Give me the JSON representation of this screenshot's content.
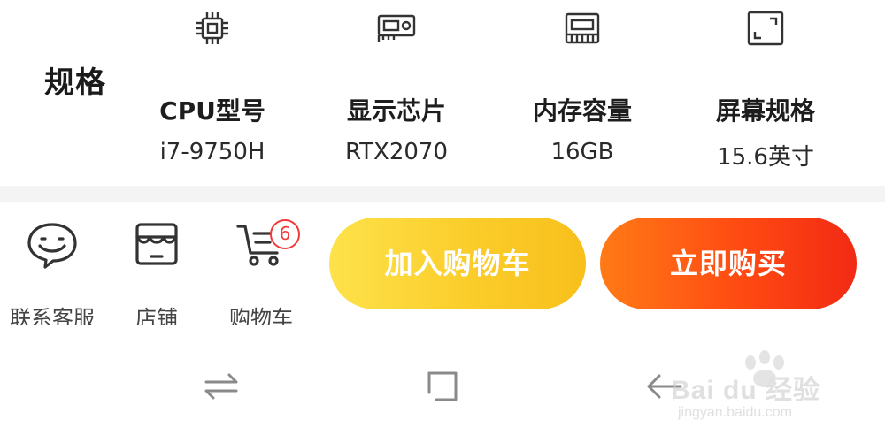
{
  "specs": {
    "label": "规格",
    "items": [
      {
        "icon": "cpu-chip-icon",
        "name": "CPU型号",
        "value": "i7-9750H"
      },
      {
        "icon": "graphics-card-icon",
        "name": "显示芯片",
        "value": "RTX2070"
      },
      {
        "icon": "memory-module-icon",
        "name": "内存容量",
        "value": "16GB"
      },
      {
        "icon": "screen-frame-icon",
        "name": "屏幕规格",
        "value": "15.6英寸"
      }
    ]
  },
  "actions": {
    "service": {
      "label": "联系客服",
      "icon": "customer-service-icon"
    },
    "store": {
      "label": "店铺",
      "icon": "store-icon"
    },
    "cart": {
      "label": "购物车",
      "icon": "shopping-cart-icon",
      "badge": "6"
    },
    "add_to_cart": "加入购物车",
    "buy_now": "立即购买"
  },
  "colors": {
    "add_to_cart": "#fbcd2a",
    "buy_now": "#ff4a12",
    "badge": "#f23a3a"
  },
  "nav": {
    "buttons": [
      "switch-apps-icon",
      "home-square-icon",
      "back-arrow-icon"
    ]
  },
  "watermark": {
    "brand": "Bai du 经验",
    "url": "jingyan.baidu.com"
  }
}
